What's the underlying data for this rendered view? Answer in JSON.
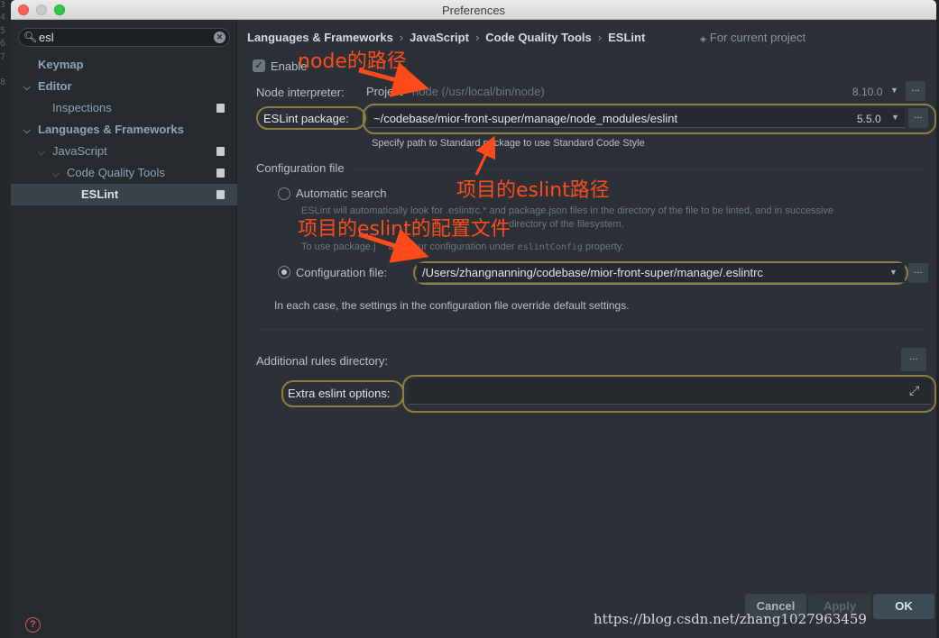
{
  "window": {
    "title": "Preferences"
  },
  "gutter": {
    "line_numbers": [
      "3",
      "4",
      "5",
      "6",
      "7",
      "8"
    ]
  },
  "search": {
    "value": "esl"
  },
  "sidebar": {
    "keymap": "Keymap",
    "editor": "Editor",
    "inspections": "Inspections",
    "languages": "Languages & Frameworks",
    "javascript": "JavaScript",
    "code_quality": "Code Quality Tools",
    "eslint": "ESLint"
  },
  "breadcrumb": {
    "items": [
      "Languages & Frameworks",
      "JavaScript",
      "Code Quality Tools",
      "ESLint"
    ],
    "separator": "›",
    "scope": "For current project"
  },
  "enable": {
    "label": "Enable",
    "checked": true
  },
  "node": {
    "label": "Node interpreter:",
    "value_prefix": "Project",
    "value": "node (/usr/local/bin/node)",
    "version": "8.10.0"
  },
  "eslint_package": {
    "label": "ESLint package:",
    "value": "~/codebase/mior-front-super/manage/node_modules/eslint",
    "version": "5.5.0",
    "hint": "Specify path to Standard package to use Standard Code Style"
  },
  "config": {
    "section": "Configuration file",
    "auto_label": "Automatic search",
    "auto_desc_1": "ESLint will automatically look for .eslintrc.* and package.json files in the directory of the file to be linted, and in successive",
    "auto_desc_2": "directory of the filesystem.",
    "auto_desc_3_a": "To use package.j",
    "auto_desc_3_b": "add your configuration under",
    "auto_desc_3_code": "eslintConfig",
    "auto_desc_3_c": "property.",
    "file_label": "Configuration file:",
    "file_value": "/Users/zhangnanning/codebase/mior-front-super/manage/.eslintrc",
    "note": "In each case, the settings in the configuration file override default settings."
  },
  "additional_rules": {
    "label": "Additional rules directory:"
  },
  "extra_options": {
    "label": "Extra eslint options:",
    "value": ""
  },
  "dots": "...",
  "buttons": {
    "cancel": "Cancel",
    "apply": "Apply",
    "ok": "OK"
  },
  "help": "?",
  "annotations": {
    "node_path": "node的路径",
    "eslint_path": "项目的eslint路径",
    "eslint_config": "项目的eslint的配置文件"
  },
  "watermark": "https://blog.csdn.net/zhang1027963459",
  "colors": {
    "annotation": "#ff4a1c",
    "highlight": "#8d7f3f",
    "selection": "#39434b"
  }
}
